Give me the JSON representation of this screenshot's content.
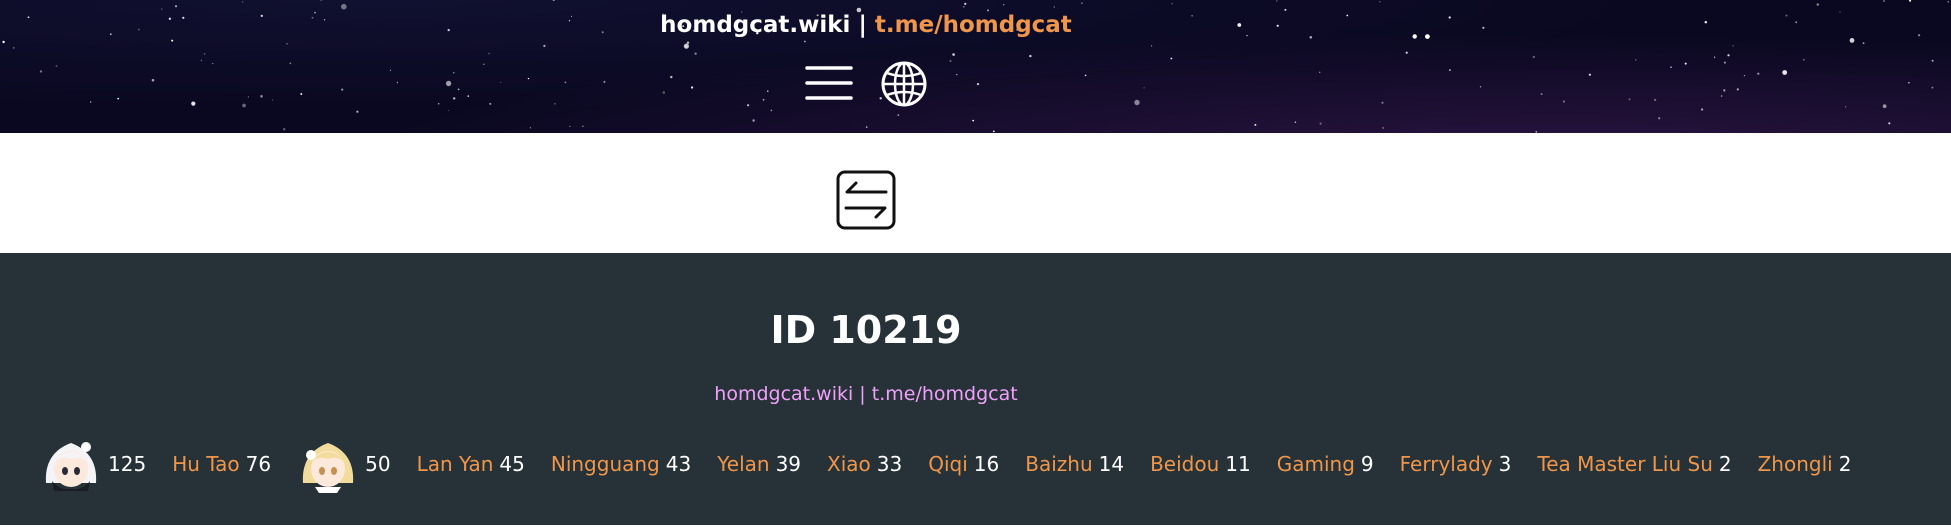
{
  "header": {
    "site": "homdgcat.wiki",
    "separator": "|",
    "telegram": "t.me/homdgcat",
    "menu_icon": "hamburger-menu-icon",
    "language_icon": "globe-icon"
  },
  "toolbar": {
    "swap_icon": "swap-arrows-icon"
  },
  "panel": {
    "title": "ID 10219",
    "links": "homdgcat.wiki | t.me/homdgcat"
  },
  "characters": [
    {
      "name": "",
      "count": "125",
      "avatar": "paimon-avatar"
    },
    {
      "name": "Hu Tao",
      "count": "76"
    },
    {
      "name": "",
      "count": "50",
      "avatar": "lumine-avatar"
    },
    {
      "name": "Lan Yan",
      "count": "45"
    },
    {
      "name": "Ningguang",
      "count": "43"
    },
    {
      "name": "Yelan",
      "count": "39"
    },
    {
      "name": "Xiao",
      "count": "33"
    },
    {
      "name": "Qiqi",
      "count": "16"
    },
    {
      "name": "Baizhu",
      "count": "14"
    },
    {
      "name": "Beidou",
      "count": "11"
    },
    {
      "name": "Gaming",
      "count": "9"
    },
    {
      "name": "Ferrylady",
      "count": "3"
    },
    {
      "name": "Tea Master Liu Su",
      "count": "2"
    },
    {
      "name": "Zhongli",
      "count": "2"
    }
  ],
  "colors": {
    "header_bg": "#0a0820",
    "panel_bg": "#263238",
    "accent_orange": "#f0964a",
    "link_pink": "#f0a0f8"
  }
}
